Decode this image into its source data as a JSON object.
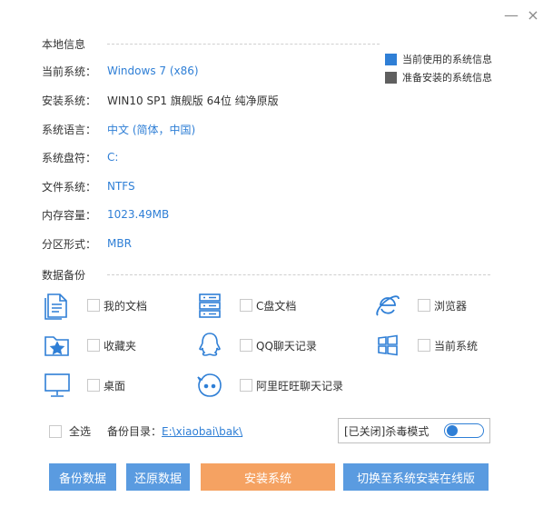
{
  "colors": {
    "accent": "#2f7fd6",
    "current_legend": "#2f7fd6",
    "target_legend": "#5f5f5f",
    "button_blue": "#5a9be0",
    "button_orange": "#f5a262"
  },
  "window": {
    "minimize_label": "—",
    "close_label": "×"
  },
  "local_info": {
    "title": "本地信息",
    "rows": [
      {
        "label": "当前系统：",
        "value": "Windows 7 (x86)"
      },
      {
        "label": "安装系统：",
        "value": "WIN10 SP1 旗舰版 64位 纯净原版"
      },
      {
        "label": "系统语言：",
        "value": "中文 (简体，中国)"
      },
      {
        "label": "系统盘符：",
        "value": "C:"
      },
      {
        "label": "文件系统：",
        "value": "NTFS"
      },
      {
        "label": "内存容量：",
        "value": "1023.49MB"
      },
      {
        "label": "分区形式：",
        "value": "MBR"
      }
    ]
  },
  "legend": {
    "current": "当前使用的系统信息",
    "target": "准备安装的系统信息"
  },
  "backup": {
    "title": "数据备份",
    "items": [
      {
        "label": "我的文档",
        "icon": "document-icon"
      },
      {
        "label": "C盘文档",
        "icon": "server-icon"
      },
      {
        "label": "浏览器",
        "icon": "browser-icon"
      },
      {
        "label": "收藏夹",
        "icon": "favorites-folder-icon"
      },
      {
        "label": "QQ聊天记录",
        "icon": "qq-icon"
      },
      {
        "label": "当前系统",
        "icon": "windows-icon"
      },
      {
        "label": "桌面",
        "icon": "monitor-icon"
      },
      {
        "label": "阿里旺旺聊天记录",
        "icon": "wangwang-icon"
      }
    ],
    "select_all": "全选",
    "dir_label": "备份目录：",
    "dir_path": "E:\\xiaobai\\bak\\",
    "antivirus_label": "[已关闭]杀毒模式"
  },
  "buttons": {
    "backup": "备份数据",
    "restore": "还原数据",
    "install": "安装系统",
    "switch": "切换至系统安装在线版"
  }
}
